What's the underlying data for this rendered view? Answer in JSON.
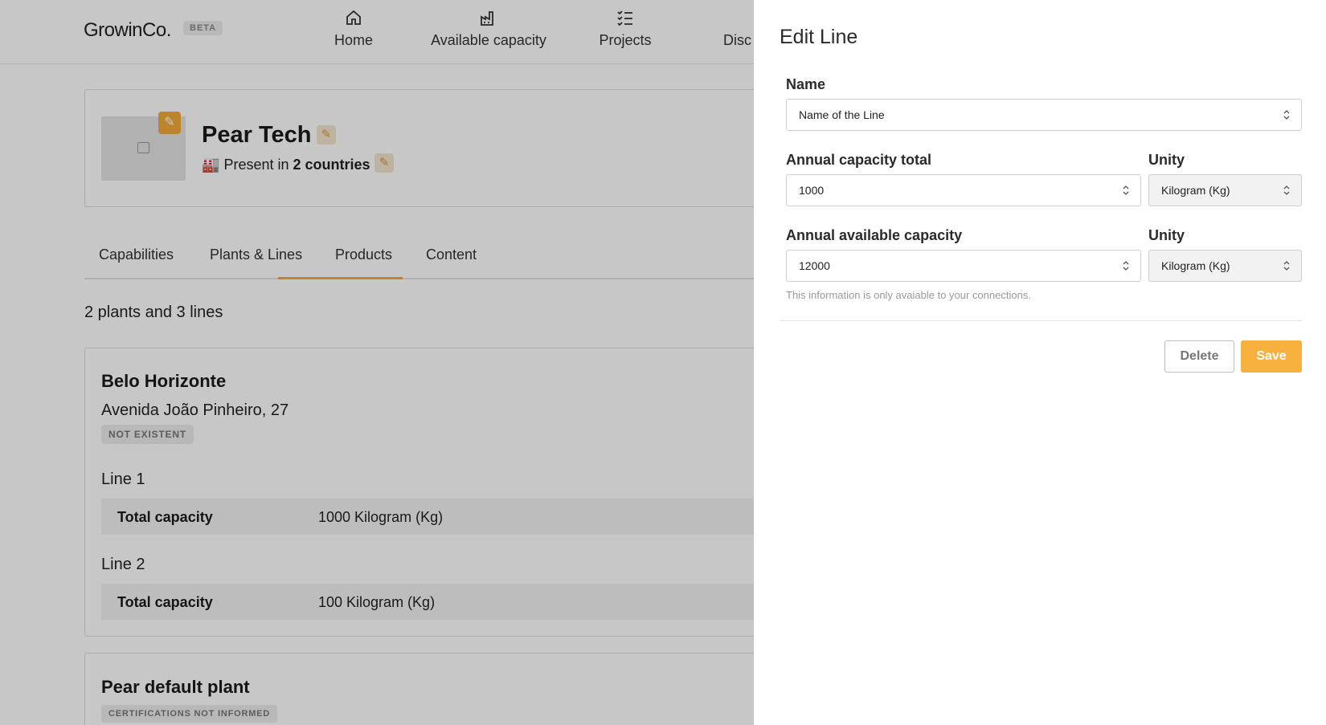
{
  "nav": {
    "logo": "GrowinCo.",
    "beta": "BETA",
    "items": [
      {
        "label": "Home",
        "icon": "home-icon"
      },
      {
        "label": "Available capacity",
        "icon": "factory-icon"
      },
      {
        "label": "Projects",
        "icon": "checklist-icon"
      },
      {
        "label": "Disc",
        "icon": ""
      }
    ]
  },
  "company": {
    "name": "Pear Tech",
    "present_prefix": "Present in",
    "present_count": "2 countries"
  },
  "tabs": [
    "Capabilities",
    "Plants & Lines",
    "Products",
    "Content"
  ],
  "active_tab": "Plants & Lines",
  "summary": "2 plants and 3 lines",
  "plants": [
    {
      "name": "Belo Horizonte",
      "address": "Avenida João Pinheiro, 27",
      "status": "NOT EXISTENT",
      "lines": [
        {
          "title": "Line 1",
          "label": "Total capacity",
          "value": "1000 Kilogram (Kg)"
        },
        {
          "title": "Line 2",
          "label": "Total capacity",
          "value": "100 Kilogram (Kg)"
        }
      ]
    },
    {
      "name": "Pear default plant",
      "status": "CERTIFICATIONS NOT INFORMED"
    }
  ],
  "drawer": {
    "title": "Edit Line",
    "name_label": "Name",
    "name_value": "Name of the Line",
    "total_label": "Annual capacity total",
    "total_value": "1000",
    "unity_label": "Unity",
    "unity_value": "Kilogram (Kg)",
    "available_label": "Annual available capacity",
    "available_value": "12000",
    "unity2_label": "Unity",
    "unity2_value": "Kilogram (Kg)",
    "hint": "This information is only avaiable to your connections.",
    "delete_label": "Delete",
    "save_label": "Save"
  },
  "colors": {
    "accent": "#f7b13e",
    "overlay": "rgba(0,0,0,0.22)"
  }
}
